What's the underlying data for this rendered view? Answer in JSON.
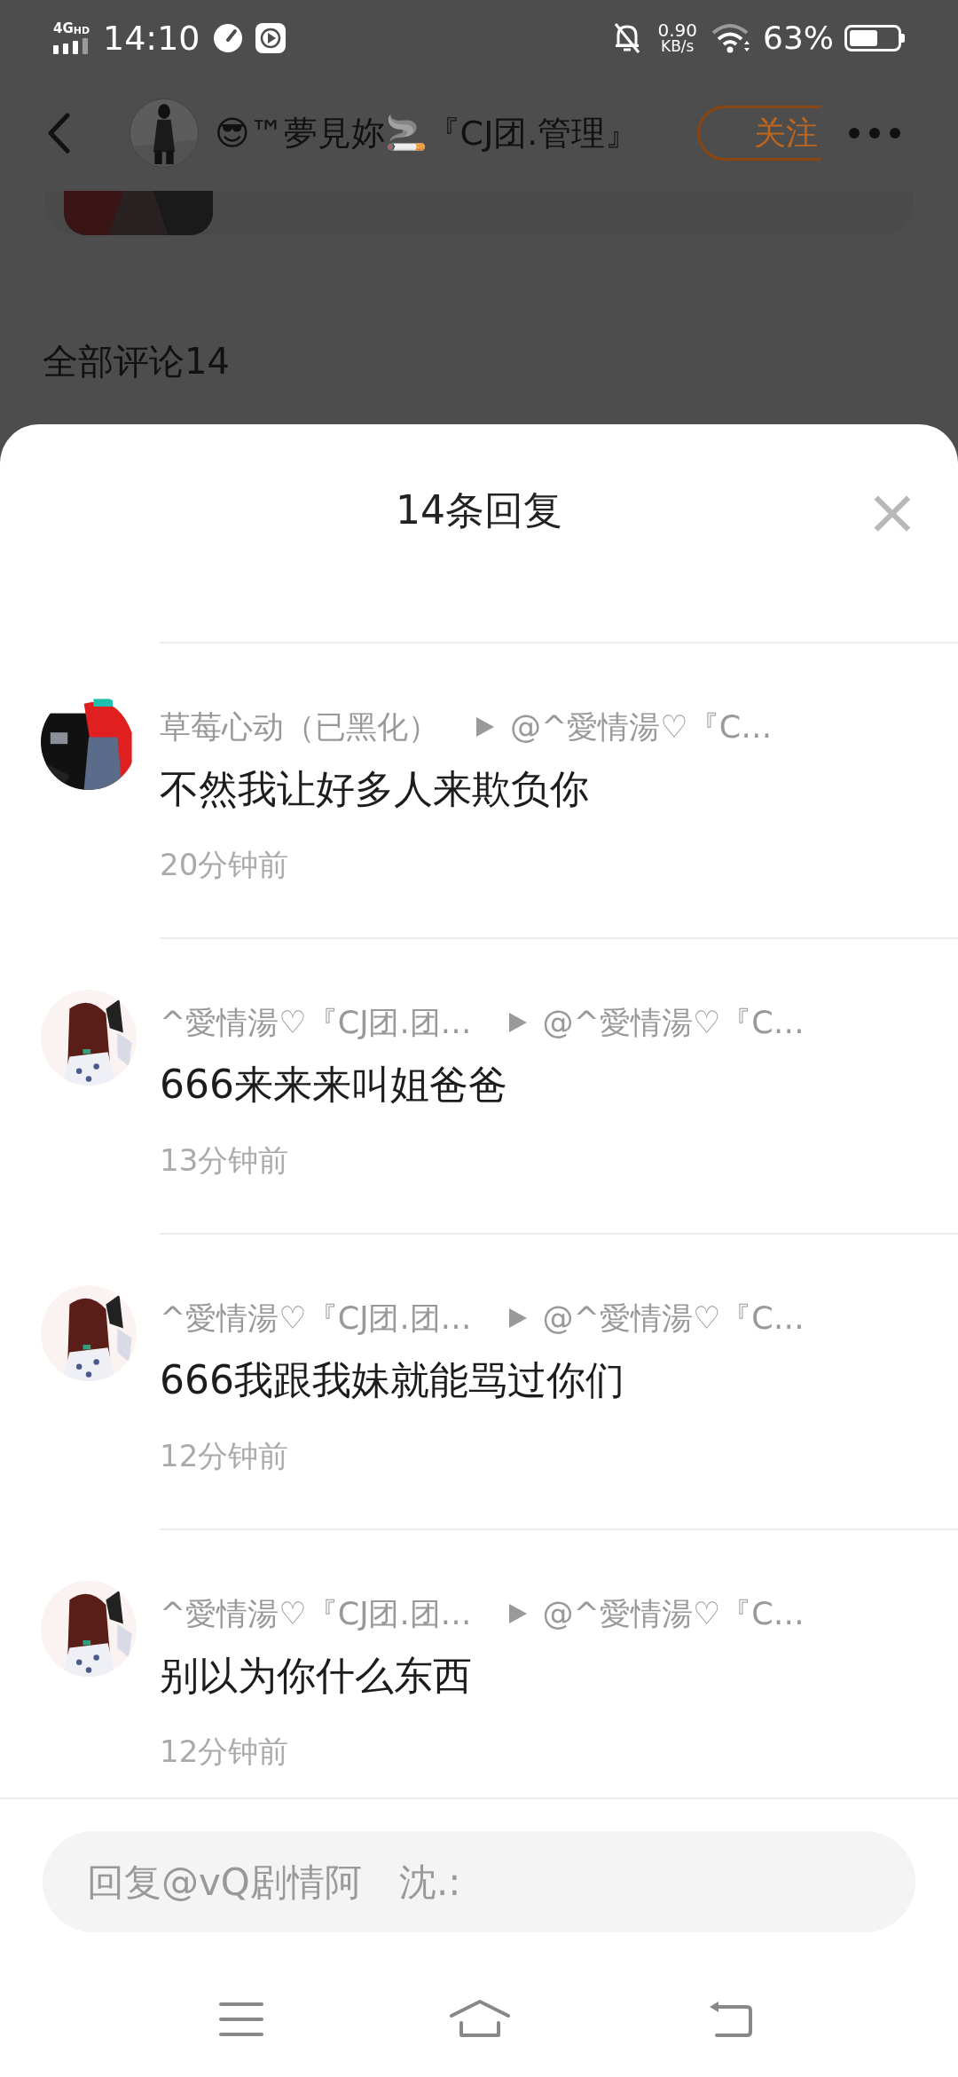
{
  "status_bar": {
    "network": "4G",
    "network_badge": "HD",
    "time": "14:10",
    "speed": "0.90",
    "speed_unit": "KB/s",
    "battery": "63%"
  },
  "header": {
    "title": "😎™夢見妳🚬『CJ团.管理』",
    "follow": "关注"
  },
  "background": {
    "comments_heading": "全部评论14"
  },
  "sheet": {
    "title": "14条回复",
    "close": "×",
    "replies": [
      {
        "author": "草莓心动（已黑化）",
        "target": "@^愛情湯♡『C…",
        "body": "不然我让好多人来欺负你",
        "time": "20分钟前"
      },
      {
        "author": "^愛情湯♡『CJ团.团…",
        "target": "@^愛情湯♡『C…",
        "body": "666来来来叫姐爸爸",
        "time": "13分钟前"
      },
      {
        "author": "^愛情湯♡『CJ团.团…",
        "target": "@^愛情湯♡『C…",
        "body": "666我跟我妹就能骂过你们",
        "time": "12分钟前"
      },
      {
        "author": "^愛情湯♡『CJ团.团…",
        "target": "@^愛情湯♡『C…",
        "body": "别以为你什么东西",
        "time": "12分钟前"
      }
    ],
    "reply_input": {
      "placeholder": "回复@vQ剧情阿　沈.:"
    }
  }
}
